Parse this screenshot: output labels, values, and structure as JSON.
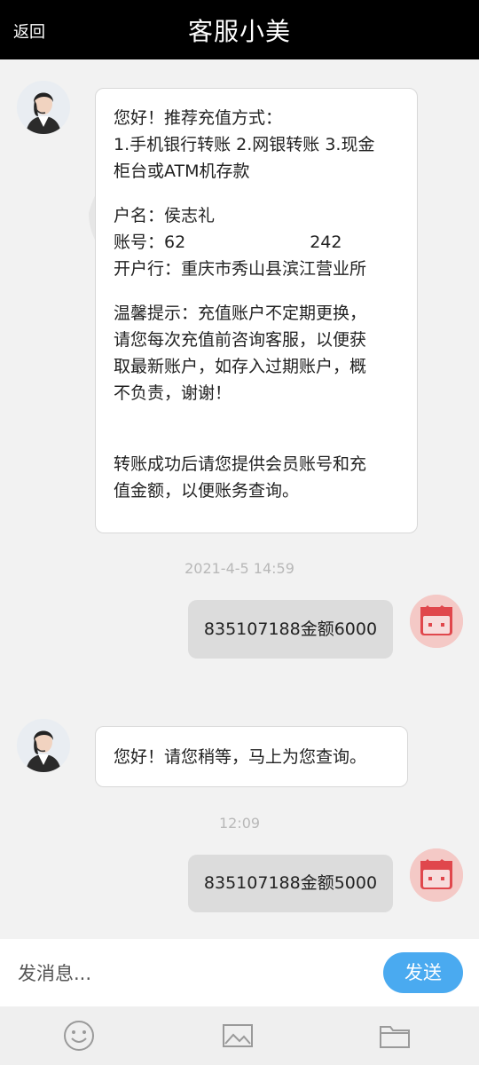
{
  "header": {
    "back_label": "返回",
    "title": "客服小美"
  },
  "messages": {
    "m1": {
      "intro": "您好！推荐充值方式：",
      "methods_1": "1.手机银行转账 2.网银转账 3.现金",
      "methods_2": "柜台或ATM机存款",
      "account_name": "户名：侯志礼",
      "account_no_prefix": "账号：62",
      "account_no_suffix": "242",
      "bank": "开户行：重庆市秀山县滨江营业所",
      "tip_1": "温馨提示：充值账户不定期更换，",
      "tip_2": "请您每次充值前咨询客服，以便获",
      "tip_3": "取最新账户，如存入过期账户，概",
      "tip_4": "不负责，谢谢！",
      "after_1": "转账成功后请您提供会员账号和充",
      "after_2": "值金额，以便账务查询。"
    },
    "t1": "2021-4-5 14:59",
    "m2": "835107188金额6000",
    "m3": "您好！请您稍等，马上为您查询。",
    "t2": "12:09",
    "m4": "835107188金额5000"
  },
  "composer": {
    "placeholder": "发消息...",
    "send_label": "发送"
  },
  "toolbar": {
    "icons": [
      "emoji-icon",
      "image-icon",
      "folder-icon"
    ]
  },
  "colors": {
    "header_bg": "#000000",
    "send_button": "#4aaaf0",
    "user_bubble": "#dcdcdc"
  }
}
